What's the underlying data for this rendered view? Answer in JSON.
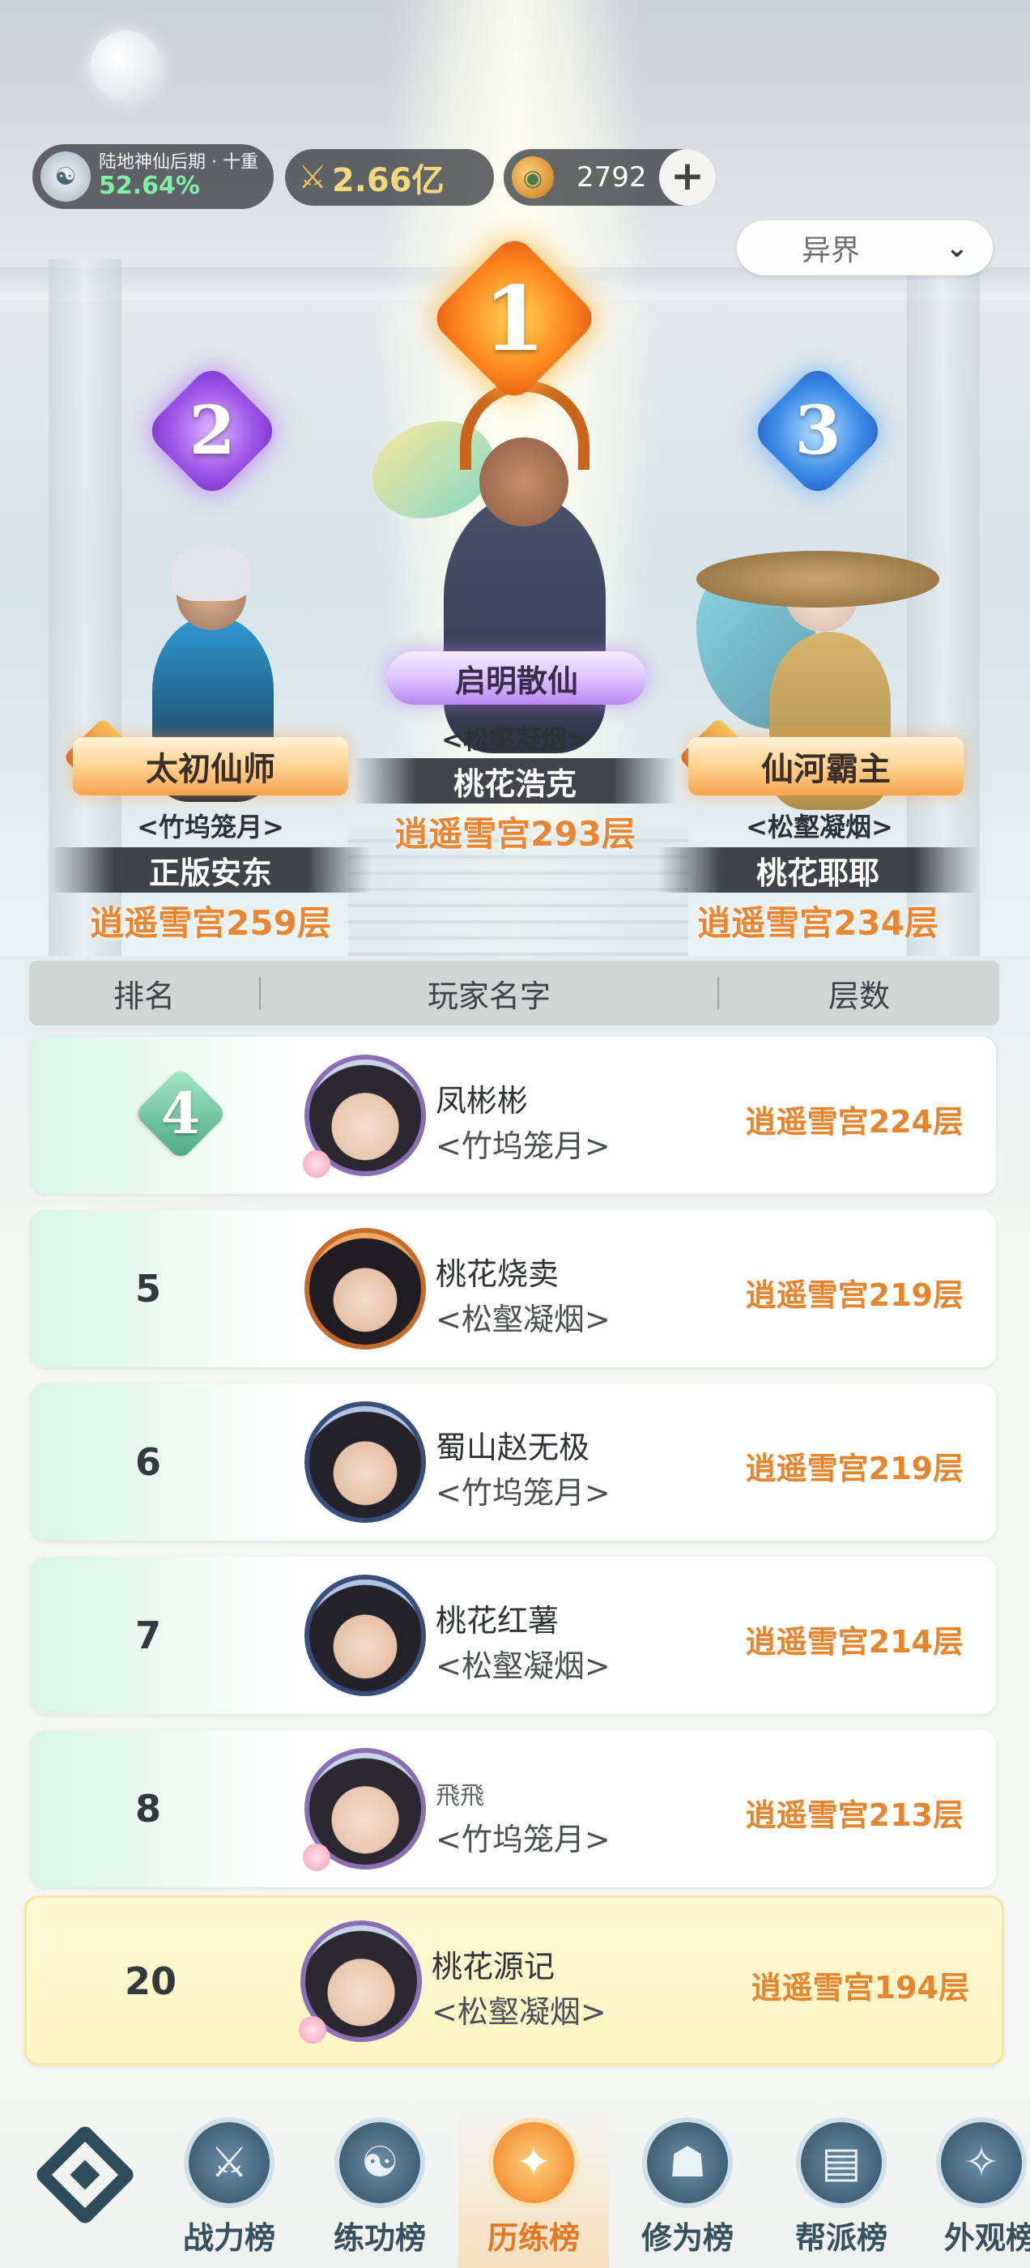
{
  "status": {
    "realm_name": "陆地神仙后期 · 十重",
    "realm_progress": "52.64%",
    "power_value": "2.66亿",
    "currency_value": "2792",
    "add_label": "+"
  },
  "server_select": {
    "value": "异界"
  },
  "podium": [
    {
      "rank": "1",
      "title": "启明散仙",
      "guild": "<松壑凝烟>",
      "name": "桃花浩克",
      "floor": "逍遥雪宫293层"
    },
    {
      "rank": "2",
      "title": "太初仙师",
      "guild": "<竹坞笼月>",
      "name": "正版安东",
      "floor": "逍遥雪宫259层"
    },
    {
      "rank": "3",
      "title": "仙河霸主",
      "guild": "<松壑凝烟>",
      "name": "桃花耶耶",
      "floor": "逍遥雪宫234层"
    }
  ],
  "table": {
    "headers": {
      "rank": "排名",
      "player": "玩家名字",
      "floor": "层数"
    },
    "rows": [
      {
        "rank": "4",
        "name": "凤彬彬",
        "guild": "<竹坞笼月>",
        "floor": "逍遥雪宫224层"
      },
      {
        "rank": "5",
        "name": "桃花烧卖",
        "guild": "<松壑凝烟>",
        "floor": "逍遥雪宫219层"
      },
      {
        "rank": "6",
        "name": "蜀山赵无极",
        "guild": "<竹坞笼月>",
        "floor": "逍遥雪宫219层"
      },
      {
        "rank": "7",
        "name": "桃花红薯",
        "guild": "<松壑凝烟>",
        "floor": "逍遥雪宫214层"
      },
      {
        "rank": "8",
        "name": "飛飛",
        "guild": "<竹坞笼月>",
        "floor": "逍遥雪宫213层"
      }
    ],
    "self_row": {
      "rank": "20",
      "name": "桃花源记",
      "guild": "<松壑凝烟>",
      "floor": "逍遥雪宫194层"
    }
  },
  "nav": {
    "items": [
      {
        "label": "战力榜",
        "icon": "sword-icon"
      },
      {
        "label": "练功榜",
        "icon": "yinyang-icon"
      },
      {
        "label": "历练榜",
        "icon": "star-compass-icon"
      },
      {
        "label": "修为榜",
        "icon": "cultivator-icon"
      },
      {
        "label": "帮派榜",
        "icon": "scroll-icon"
      },
      {
        "label": "外观榜",
        "icon": "costume-icon"
      }
    ],
    "active_index": 2
  },
  "colors": {
    "accent_orange": "#e4862f",
    "rank1": "#ff8b1f",
    "rank2": "#9f57e8",
    "rank3": "#3e8fe8",
    "self_row_bg": "#fff5c4"
  }
}
